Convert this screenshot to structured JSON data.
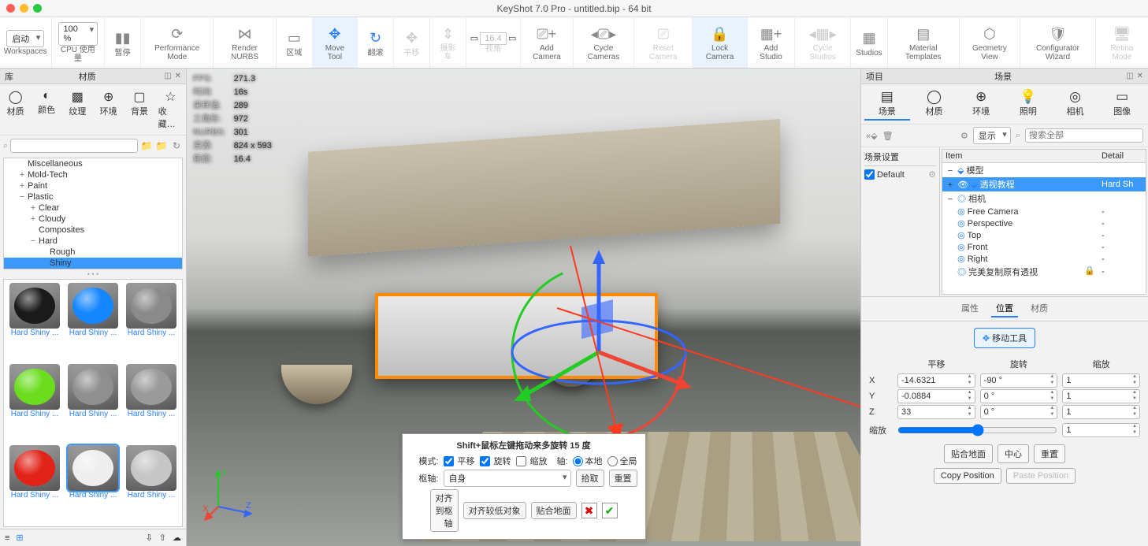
{
  "title": "KeyShot 7.0 Pro  - untitled.bip  - 64 bit",
  "toolbar": {
    "launch": "启动",
    "workspaces": "Workspaces",
    "cpu_pct": "100 %",
    "cpu_label": "CPU 使用量",
    "pause": "暂停",
    "perf": "Performance Mode",
    "nurbs": "Render NURBS",
    "region": "区域",
    "move_tool": "Move Tool",
    "roll": "翻滚",
    "pan": "平移",
    "dolly": "摄影车",
    "fov_val": "16.4",
    "view": "视角",
    "add_cam": "Add Camera",
    "cycle_cam": "Cycle Cameras",
    "reset_cam": "Reset Camera",
    "lock_cam": "Lock Camera",
    "add_studio": "Add Studio",
    "cycle_studio": "Cycle Studios",
    "studios": "Studios",
    "mat_tpl": "Material Templates",
    "geom_view": "Geometry View",
    "cfg_wiz": "Configurator Wizard",
    "retina": "Retina Mode"
  },
  "library": {
    "head_left": "库",
    "head_center": "材质",
    "tabs": [
      "材质",
      "颜色",
      "纹理",
      "环境",
      "背景",
      "收藏…"
    ],
    "search_ph": "",
    "tree": [
      {
        "t": "",
        "l": "Miscellaneous",
        "i": 1
      },
      {
        "t": "+",
        "l": "Mold-Tech",
        "i": 1
      },
      {
        "t": "+",
        "l": "Paint",
        "i": 1
      },
      {
        "t": "−",
        "l": "Plastic",
        "i": 1
      },
      {
        "t": "+",
        "l": "Clear",
        "i": 2
      },
      {
        "t": "+",
        "l": "Cloudy",
        "i": 2
      },
      {
        "t": "",
        "l": "Composites",
        "i": 2
      },
      {
        "t": "−",
        "l": "Hard",
        "i": 2
      },
      {
        "t": "",
        "l": "Rough",
        "i": 3
      },
      {
        "t": "",
        "l": "Shiny",
        "i": 3,
        "sel": true
      }
    ],
    "thumbs": [
      {
        "c": "#1a1a1a",
        "n": "Hard Shiny ..."
      },
      {
        "c": "#1486ff",
        "n": "Hard Shiny ..."
      },
      {
        "c": "#8a8a8a",
        "n": "Hard Shiny ..."
      },
      {
        "c": "#6bdd1e",
        "n": "Hard Shiny ..."
      },
      {
        "c": "#8f8f8f",
        "n": "Hard Shiny ..."
      },
      {
        "c": "#9a9a9a",
        "n": "Hard Shiny ..."
      },
      {
        "c": "#e22318",
        "n": "Hard Shiny ..."
      },
      {
        "c": "#eeeeee",
        "n": "Hard Shiny ...",
        "sel": true
      },
      {
        "c": "#c6c6c6",
        "n": "Hard Shiny ..."
      }
    ]
  },
  "stats": [
    [
      "FPS:",
      "271.3"
    ],
    [
      "时间:",
      "16s"
    ],
    [
      "采样值:",
      "289"
    ],
    [
      "三角形:",
      "972"
    ],
    [
      "NURBS:",
      "301"
    ],
    [
      "资源:",
      "824 x 593"
    ],
    [
      "焦距:",
      "16.4"
    ]
  ],
  "axes": {
    "x": "X",
    "y": "Y",
    "z": "Z"
  },
  "move_dialog": {
    "title": "Shift+鼠标左键拖动来多旋转 15 度",
    "mode": "模式:",
    "translate": "平移",
    "rotate": "旋转",
    "scale": "缩放",
    "axis": "轴:",
    "local": "本地",
    "global": "全局",
    "pivot": "枢轴:",
    "self": "自身",
    "pick": "拾取",
    "reset": "重置",
    "align_pivot": "对齐到枢轴",
    "align_low": "对齐较低对象",
    "snap_gnd": "贴合地面"
  },
  "project": {
    "head_left": "项目",
    "head_center": "场景",
    "tabs": [
      "场景",
      "材质",
      "环境",
      "照明",
      "相机",
      "图像"
    ],
    "show": "显示",
    "search_ph": "搜索全部",
    "scene_settings": "场景设置",
    "default": "Default",
    "col_item": "Item",
    "col_detail": "Detail",
    "tree": [
      {
        "t": "−",
        "ico": "⬙",
        "l": "模型"
      },
      {
        "t": "+",
        "ico": "👁",
        "ext": "⬙",
        "l": "透视教程",
        "d": "Hard Sh",
        "sel": true
      },
      {
        "t": "−",
        "ico": "◎",
        "l": "相机"
      },
      {
        "t": "",
        "ico": "◎",
        "l": "Free Camera",
        "d": "-"
      },
      {
        "t": "",
        "ico": "◎",
        "l": "Perspective",
        "d": "-"
      },
      {
        "t": "",
        "ico": "◎",
        "l": "Top",
        "d": "-"
      },
      {
        "t": "",
        "ico": "◎",
        "l": "Front",
        "d": "-"
      },
      {
        "t": "",
        "ico": "◎",
        "l": "Right",
        "d": "-"
      },
      {
        "t": "",
        "ico": "◎",
        "l": "完美复制原有透视",
        "d": "-",
        "lock": true
      }
    ],
    "tabs2": [
      "属性",
      "位置",
      "材质"
    ],
    "move_tool": "移动工具",
    "h_trans": "平移",
    "h_rot": "旋转",
    "h_scale": "缩放",
    "x": "X",
    "y": "Y",
    "z": "Z",
    "scl": "缩放",
    "tx": "-14.6321",
    "ty": "-0.0884",
    "tz": "33",
    "rx": "-90 °",
    "ry": "0 °",
    "rz": "0 °",
    "sx": "1",
    "sy": "1",
    "sz": "1",
    "sv": "1",
    "snap": "贴合地面",
    "center": "中心",
    "reset": "重置",
    "copy": "Copy Position",
    "paste": "Paste Position"
  }
}
